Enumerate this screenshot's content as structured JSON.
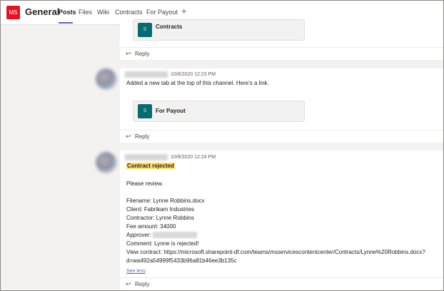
{
  "header": {
    "team_initials": "MS",
    "channel_title": "General",
    "tabs": [
      {
        "label": "Posts"
      },
      {
        "label": "Files"
      },
      {
        "label": "Wiki"
      },
      {
        "label": "Contracts"
      },
      {
        "label": "For Payout"
      }
    ],
    "add_tab_icon": "+"
  },
  "colors": {
    "accent": "#6264a7",
    "team_avatar": "#e81123",
    "sharepoint": "#036c70",
    "highlight": "#ffe066"
  },
  "messages": [
    {
      "card_label": "Contracts",
      "card_icon_glyph": "S",
      "reply_label": "Reply"
    },
    {
      "timestamp": "10/8/2020 12:23 PM",
      "text": "Added a new tab at the top of this channel. Here's a link.",
      "card_label": "For Payout",
      "card_icon_glyph": "S",
      "reply_label": "Reply"
    },
    {
      "timestamp": "10/8/2020 12:24 PM",
      "subject": "Contract rejected",
      "please_review": "Please review.",
      "filename": "Filename: Lynne Robbins.docx",
      "client": "Client: Fabrikam Industries",
      "contractor": "Contractor: Lynne Robbins",
      "fee": "Fee amount: 34000",
      "approver_label": "Approver:",
      "comment": "Comment: Lynne is rejected!",
      "view_contract_1": "View contract:  https://microsoft.sharepoint-df.com/teams/msservicescontentcenter/Contracts/Lynne%20Robbins.docx?",
      "view_contract_2": "d=wa492a54999f5433b96a81b46ee3b135c",
      "see_less": "See less",
      "reply_label": "Reply"
    }
  ]
}
